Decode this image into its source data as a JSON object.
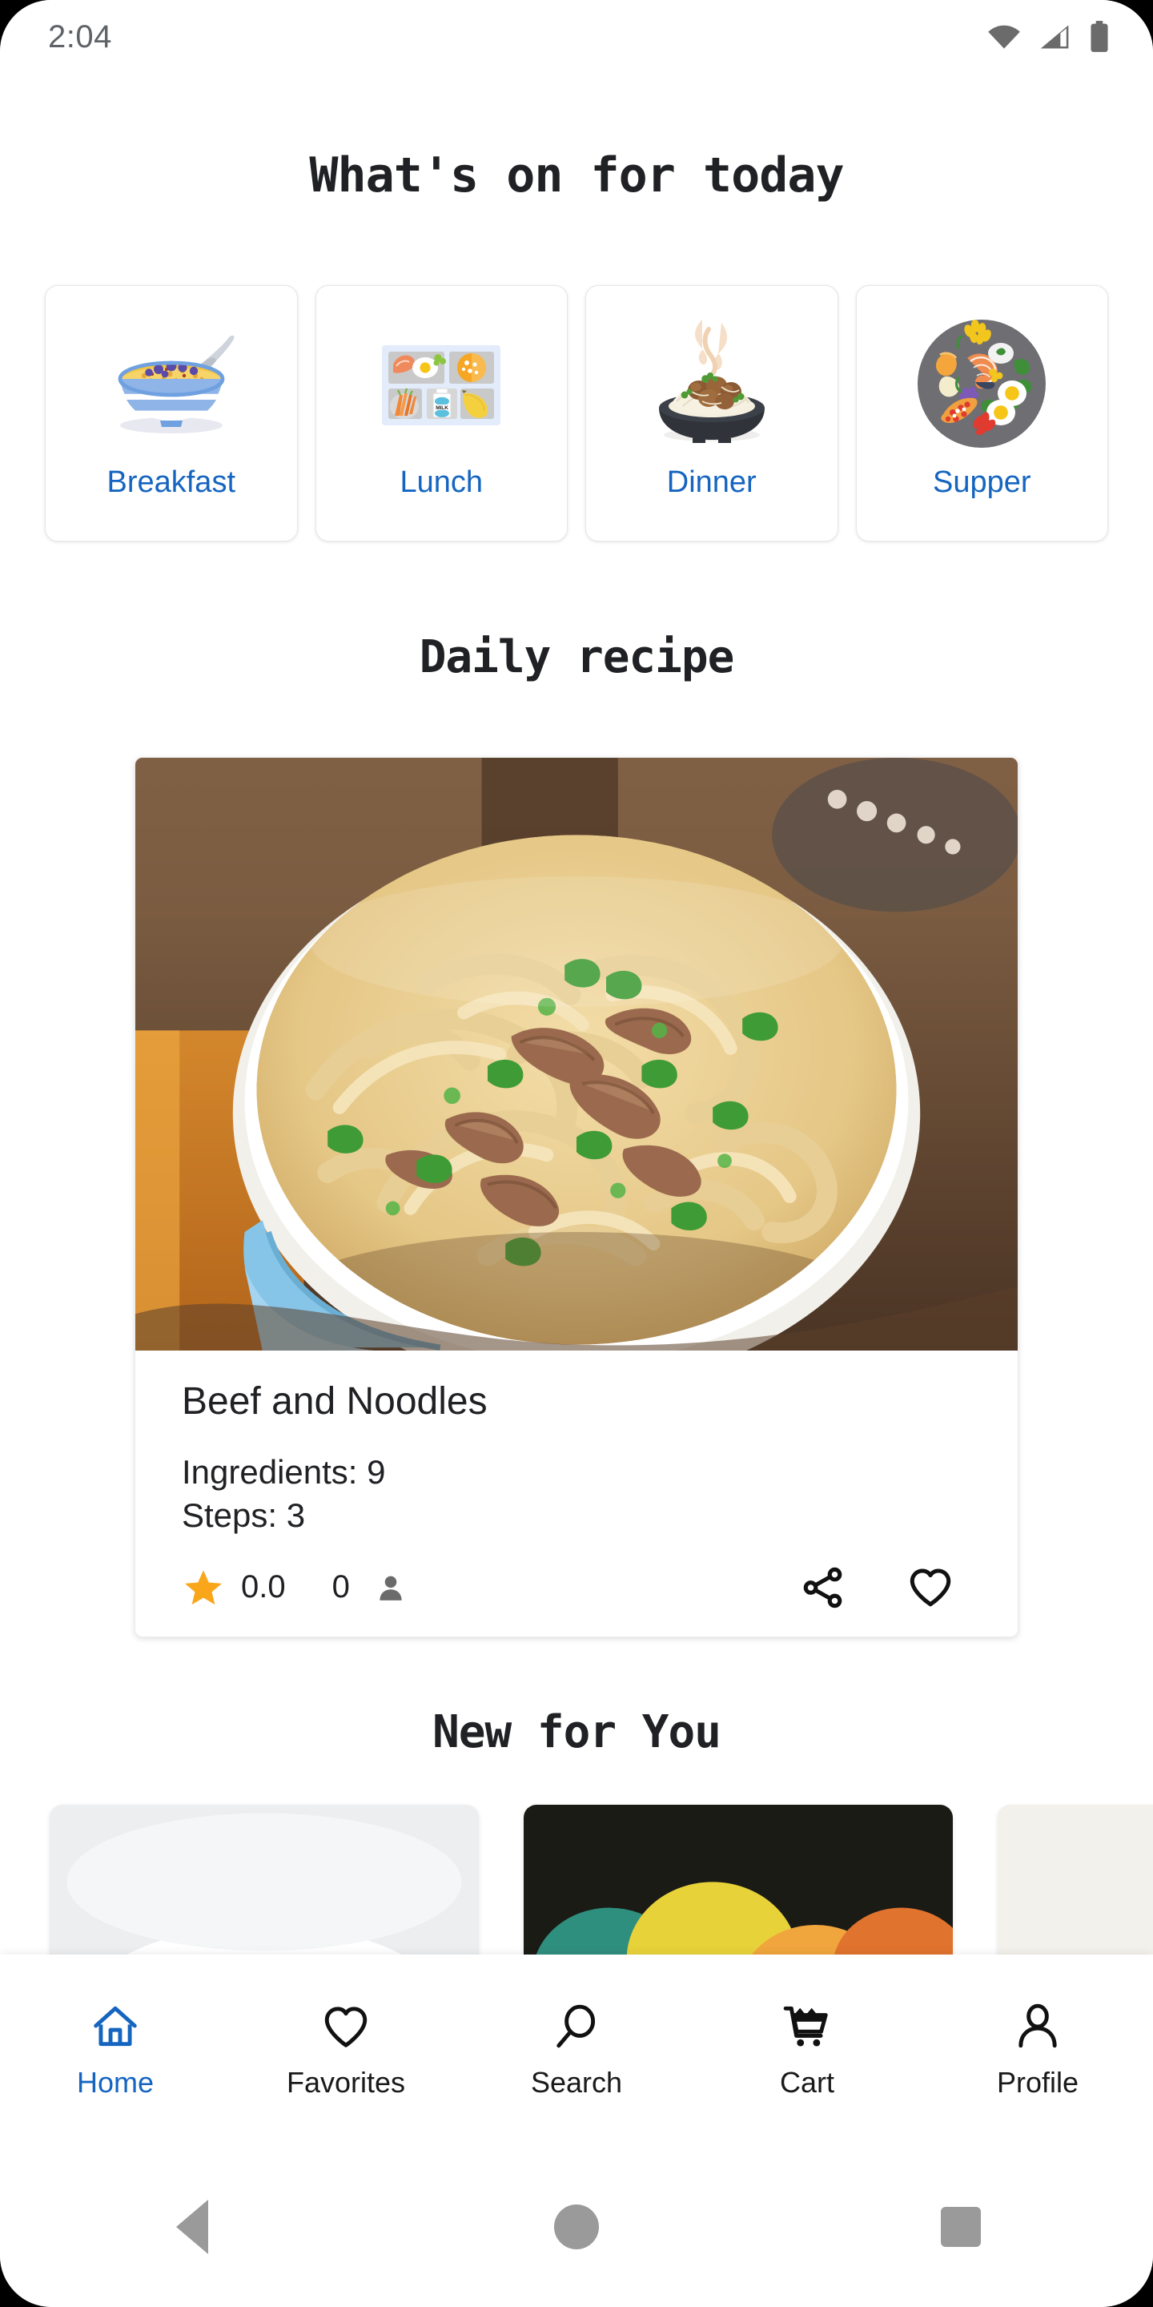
{
  "status_bar": {
    "time": "2:04",
    "icons": [
      "wifi-icon",
      "cellular-signal-icon",
      "battery-icon"
    ]
  },
  "header": {
    "title": "What's on for today"
  },
  "meal_categories": {
    "items": [
      {
        "label": "Breakfast",
        "icon": "cereal-bowl-icon"
      },
      {
        "label": "Lunch",
        "icon": "lunch-tray-icon"
      },
      {
        "label": "Dinner",
        "icon": "spaghetti-plate-icon"
      },
      {
        "label": "Supper",
        "icon": "dinner-platter-icon"
      }
    ]
  },
  "daily_recipe": {
    "section_title": "Daily recipe",
    "title": "Beef and Noodles",
    "ingredients_label": "Ingredients: 9",
    "steps_label": "Steps: 3",
    "rating": "0.0",
    "review_count": "0",
    "share_icon": "share-icon",
    "favorite_icon": "heart-outline-icon",
    "star_icon": "star-filled-icon",
    "person_icon": "person-icon",
    "photo_alt": "beef-and-noodles-photo"
  },
  "new_for_you": {
    "section_title": "New for You",
    "cards": [
      {
        "image": "pasta-dish-thumbnail"
      },
      {
        "image": "colorful-salad-thumbnail"
      },
      {
        "image": "bread-board-thumbnail"
      }
    ]
  },
  "bottom_nav": {
    "items": [
      {
        "label": "Home",
        "icon": "home-icon",
        "active": true
      },
      {
        "label": "Favorites",
        "icon": "heart-outline-icon",
        "active": false
      },
      {
        "label": "Search",
        "icon": "search-icon",
        "active": false
      },
      {
        "label": "Cart",
        "icon": "cart-icon",
        "active": false
      },
      {
        "label": "Profile",
        "icon": "person-outline-icon",
        "active": false
      }
    ]
  },
  "system_nav": {
    "back": "back-triangle-icon",
    "home": "home-circle-icon",
    "recents": "recents-square-icon"
  },
  "colors": {
    "accent_blue": "#1565C0",
    "star_orange": "#FAA61A",
    "text_primary": "#202124",
    "status_gray": "#5f6368",
    "sysnav_gray": "#9a9a9a"
  }
}
